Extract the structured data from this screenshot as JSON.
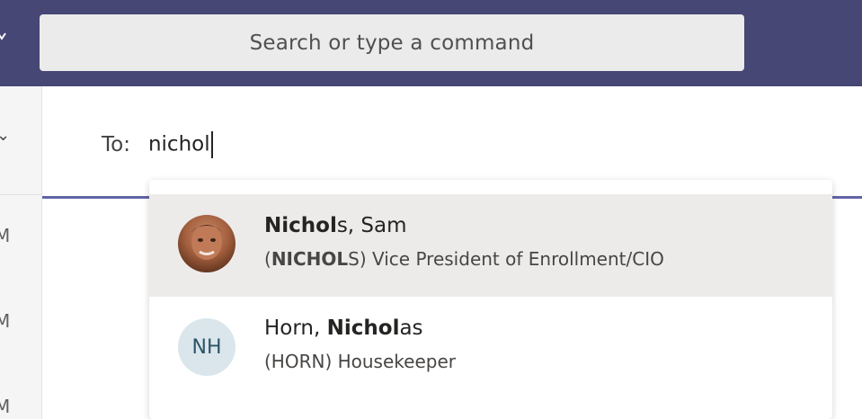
{
  "header": {
    "search_placeholder": "Search or type a command",
    "accent_color": "#464775"
  },
  "sidebar": {
    "times": [
      "M",
      "M",
      "M"
    ]
  },
  "compose": {
    "to_label": "To:",
    "to_value": "nichol"
  },
  "suggestions": [
    {
      "name_bold": "Nichol",
      "name_rest": "s, Sam",
      "detail_prefix": "(",
      "detail_bold": "NICHOL",
      "detail_rest": "S) Vice President of Enrollment/CIO",
      "avatar": "photo"
    },
    {
      "name_prefix": "Horn, ",
      "name_bold": "Nichol",
      "name_rest": "as",
      "detail": "(HORN) Housekeeper",
      "initials": "NH"
    }
  ]
}
